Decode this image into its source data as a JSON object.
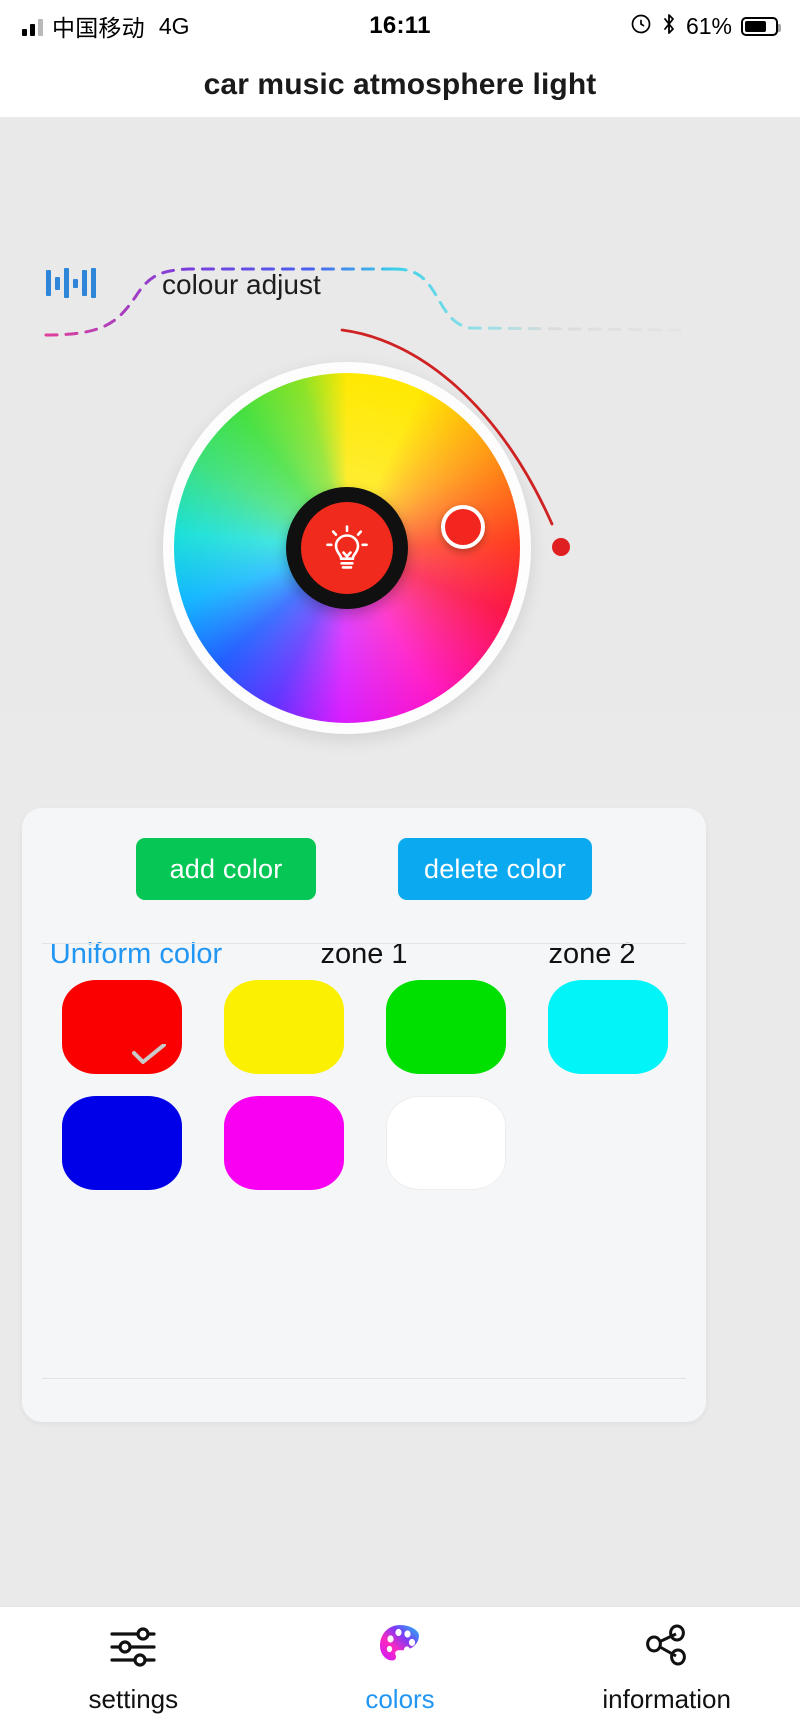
{
  "status_bar": {
    "carrier": "中国移动",
    "network": "4G",
    "time": "16:11",
    "battery_percent": "61%",
    "signal_icon": "signal-bars-icon",
    "lock_rotation_icon": "rotation-lock-icon",
    "bluetooth_icon": "bluetooth-icon",
    "battery_icon": "battery-icon"
  },
  "header": {
    "title": "car music atmosphere light"
  },
  "colour_panel": {
    "equalizer_icon": "equalizer-icon",
    "tab_label": "colour adjust",
    "wheel_icon": "color-wheel",
    "bulb_icon": "lightbulb-icon",
    "selected_color": "#f3251f",
    "brightness_handle_color": "#e02020",
    "curve_colors": [
      "#e0409a",
      "#7b3ddd",
      "#3f6ff0",
      "#39d0e8",
      "#d8d8d8"
    ]
  },
  "colors_card": {
    "add_button": "add color",
    "delete_button": "delete color",
    "add_button_color": "#06c755",
    "delete_button_color": "#0aa9f0",
    "zones": [
      {
        "label": "Uniform color",
        "active": true,
        "indicator_icon": "equalizer-icon"
      },
      {
        "label": "zone 1",
        "active": false
      },
      {
        "label": "zone 2",
        "active": false
      }
    ],
    "swatches": [
      {
        "name": "red",
        "color": "#fb0000",
        "selected": true
      },
      {
        "name": "yellow",
        "color": "#fbf000",
        "selected": false
      },
      {
        "name": "green",
        "color": "#00e000",
        "selected": false
      },
      {
        "name": "cyan",
        "color": "#00f4f8",
        "selected": false
      },
      {
        "name": "blue",
        "color": "#0000e8",
        "selected": false
      },
      {
        "name": "magenta",
        "color": "#fa00f2",
        "selected": false
      },
      {
        "name": "white",
        "color": "#ffffff",
        "selected": false
      }
    ]
  },
  "bottom_nav": [
    {
      "label": "settings",
      "icon": "sliders-icon",
      "active": false
    },
    {
      "label": "colors",
      "icon": "palette-icon",
      "active": true
    },
    {
      "label": "information",
      "icon": "share-nodes-icon",
      "active": false
    }
  ]
}
